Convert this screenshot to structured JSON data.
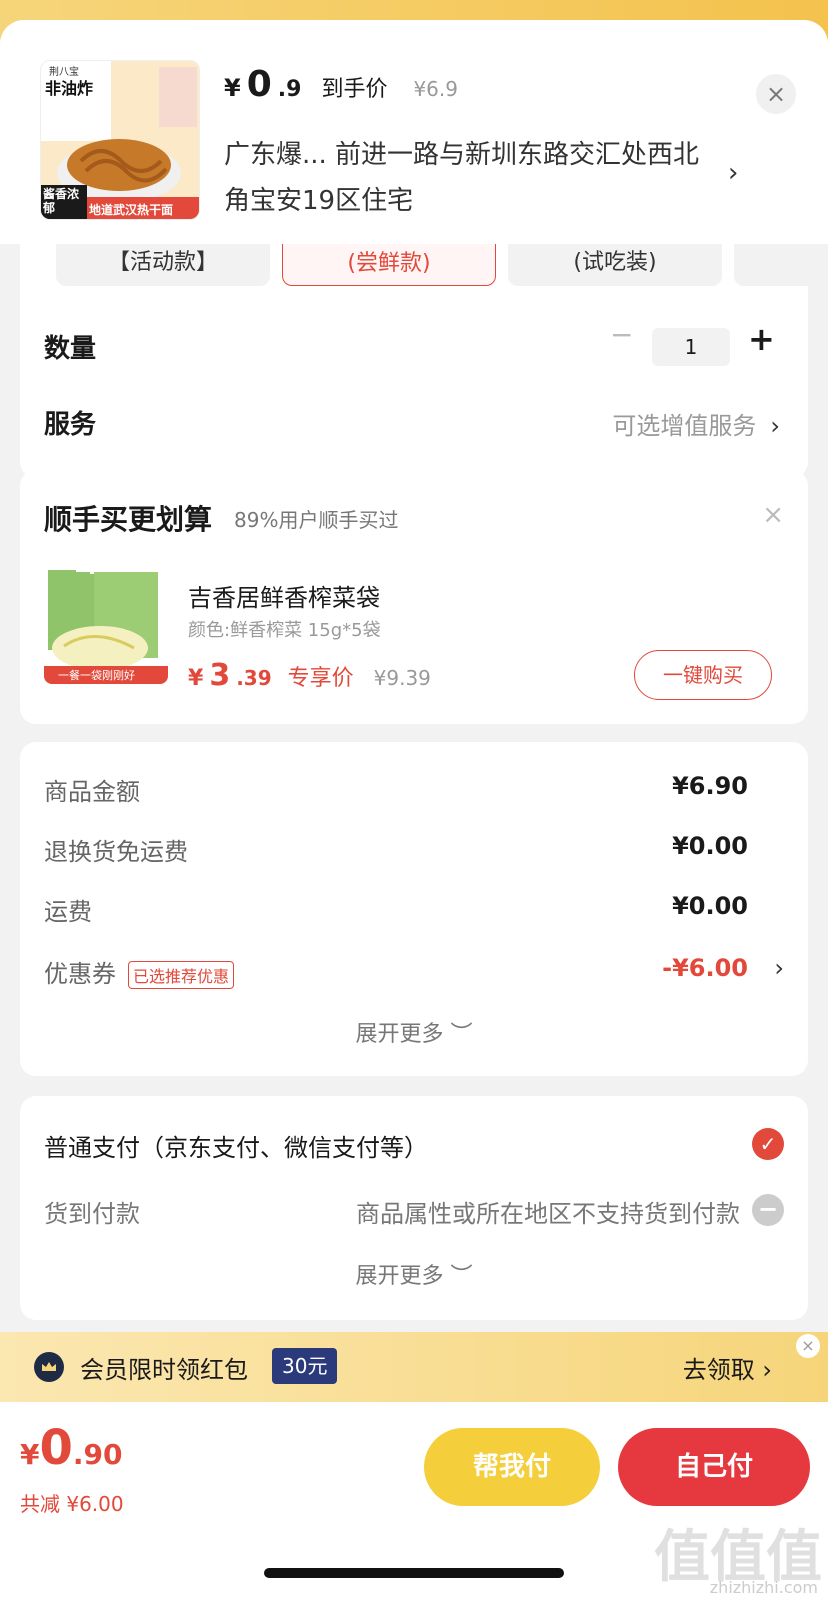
{
  "product": {
    "price_yen": "¥",
    "price_int": "0",
    "price_dec": ".9",
    "price_tag": "到手价",
    "price_orig": "¥6.9",
    "address": "广东爆... 前进一路与新圳东路交汇处西北角宝安19区住宅",
    "address_chevron": "›",
    "close": "×",
    "thumb_text_top": "荆八宝",
    "thumb_text_main": "非油炸",
    "thumb_text_bottom": "地道武汉热干面",
    "thumb_text_side": "酱香浓郁"
  },
  "options": {
    "variants": [
      {
        "label": "【活动款】"
      },
      {
        "label": "(尝鲜款)"
      },
      {
        "label": "(试吃装)"
      }
    ],
    "quantity_label": "数量",
    "quantity_minus": "−",
    "quantity_value": "1",
    "quantity_plus": "+",
    "service_label": "服务",
    "service_value": "可选增值服务",
    "service_chevron": "›"
  },
  "addon": {
    "title": "顺手买更划算",
    "subtitle": "89%用户顺手买过",
    "close": "×",
    "name": "吉香居鲜香榨菜袋",
    "spec": "颜色:鲜香榨菜 15g*5袋",
    "price_yen": "¥",
    "price_int": "3",
    "price_dec": ".39",
    "price_tag": "专享价",
    "price_orig": "¥9.39",
    "buy_button": "一键购买",
    "img_caption": "一餐一袋刚刚好"
  },
  "amounts": {
    "rows": [
      {
        "label": "商品金额",
        "value": "¥6.90"
      },
      {
        "label": "退换货免运费",
        "value": "¥0.00"
      },
      {
        "label": "运费",
        "value": "¥0.00"
      }
    ],
    "coupon_label": "优惠券",
    "coupon_badge": "已选推荐优惠",
    "coupon_value": "-¥6.00",
    "coupon_chevron": "›",
    "expand": "展开更多 ︶"
  },
  "payment": {
    "normal": "普通支付（京东支付、微信支付等）",
    "check": "✓",
    "cod_label": "货到付款",
    "cod_note": "商品属性或所在地区不支持货到付款",
    "cod_icon": "−",
    "expand": "展开更多 ︶"
  },
  "banner": {
    "text": "会员限时领红包",
    "badge": "30元",
    "cta": "去领取 ›",
    "close": "×"
  },
  "footer": {
    "total_yen": "¥",
    "total_int": "0",
    "total_dec": ".90",
    "saved": "共减 ¥6.00",
    "help_button": "帮我付",
    "self_button": "自己付"
  },
  "watermark": {
    "logo": "值值值",
    "site": "zhizhizhi.com"
  },
  "colors": {
    "accent_red": "#e2493a",
    "button_yellow": "#f5cf3b",
    "banner_yellow": "#f6d57a"
  }
}
